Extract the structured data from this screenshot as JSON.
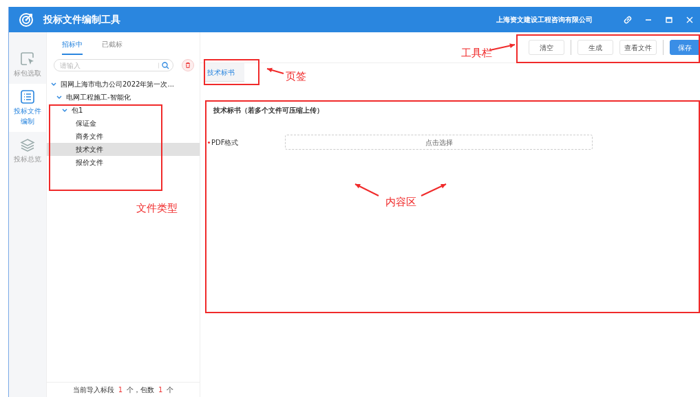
{
  "window": {
    "title": "投标文件编制工具",
    "company": "上海资文建设工程咨询有限公司"
  },
  "sidebar": {
    "items": [
      {
        "label": "标包选取",
        "selected": false
      },
      {
        "label": "投标文件编制",
        "selected": true
      },
      {
        "label": "投标总览",
        "selected": false
      }
    ]
  },
  "tree_panel": {
    "tabs": [
      {
        "label": "招标中",
        "selected": true
      },
      {
        "label": "已截标",
        "selected": false
      }
    ],
    "search": {
      "placeholder": "请输入"
    },
    "tree": [
      {
        "label": "国网上海市电力公司2022年第一次...",
        "expanded": true,
        "children": [
          {
            "label": "电网工程施工-智能化",
            "expanded": true,
            "children": [
              {
                "label": "包1",
                "expanded": true,
                "children": [
                  {
                    "label": "保证金",
                    "selected": false
                  },
                  {
                    "label": "商务文件",
                    "selected": false
                  },
                  {
                    "label": "技术文件",
                    "selected": true
                  },
                  {
                    "label": "报价文件",
                    "selected": false
                  }
                ]
              }
            ]
          }
        ]
      }
    ],
    "footer": {
      "prefix": "当前导入标段",
      "section_count": "1",
      "middle": "个，包数",
      "package_count": "1",
      "suffix": "个"
    }
  },
  "toolbar": {
    "groups": [
      [
        {
          "label": "清空",
          "kind": "default"
        }
      ],
      [
        {
          "label": "生成",
          "kind": "default"
        },
        {
          "label": "查看文件",
          "kind": "default"
        }
      ],
      [
        {
          "label": "保存",
          "kind": "primary"
        }
      ]
    ]
  },
  "tabs": [
    {
      "label": "技术标书",
      "selected": true
    }
  ],
  "content": {
    "title": "技术标书（若多个文件可压缩上传）",
    "fields": [
      {
        "label": "PDF格式",
        "required": true,
        "button": "点击选择"
      }
    ]
  },
  "annotations": [
    {
      "label": "工具栏"
    },
    {
      "label": "页签"
    },
    {
      "label": "内容区"
    },
    {
      "label": "文件类型"
    }
  ]
}
